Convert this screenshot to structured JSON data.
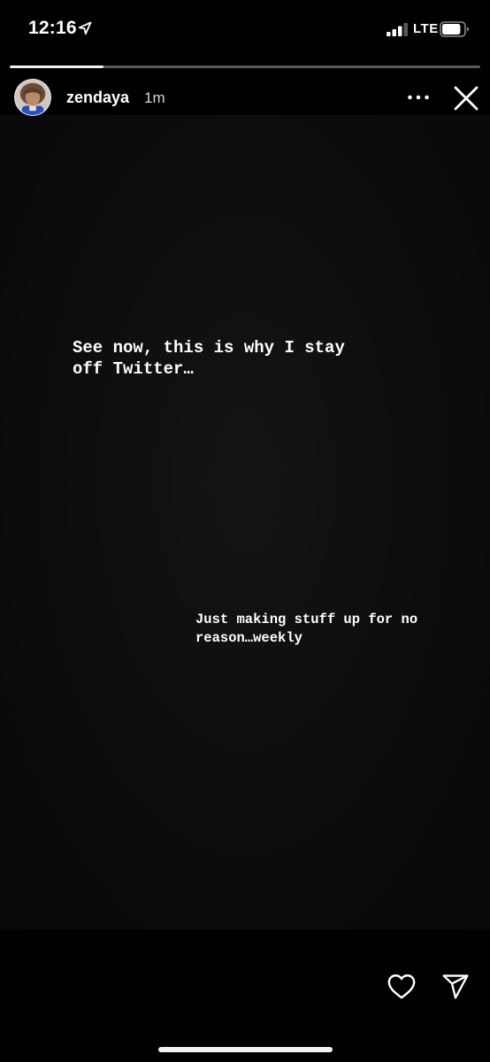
{
  "status_bar": {
    "time": "12:16",
    "network": "LTE",
    "location_icon": "location-arrow-icon",
    "signal_icon": "cellular-signal-icon",
    "battery_icon": "battery-icon",
    "signal_bars_active": 3,
    "signal_bars_total": 4,
    "battery_level": 0.85
  },
  "story": {
    "progress": 0.2,
    "username": "zendaya",
    "time_ago": "1m",
    "avatar_icon": "profile-photo",
    "more_icon": "more-options-icon",
    "close_icon": "close-icon",
    "background_color": "#0d0d0f",
    "text_blocks": [
      {
        "text": "See now, this is why I stay\noff Twitter…"
      },
      {
        "text": "Just making stuff up for no\nreason…weekly"
      }
    ]
  },
  "footer": {
    "like_icon": "heart-icon",
    "share_icon": "send-direct-icon"
  }
}
